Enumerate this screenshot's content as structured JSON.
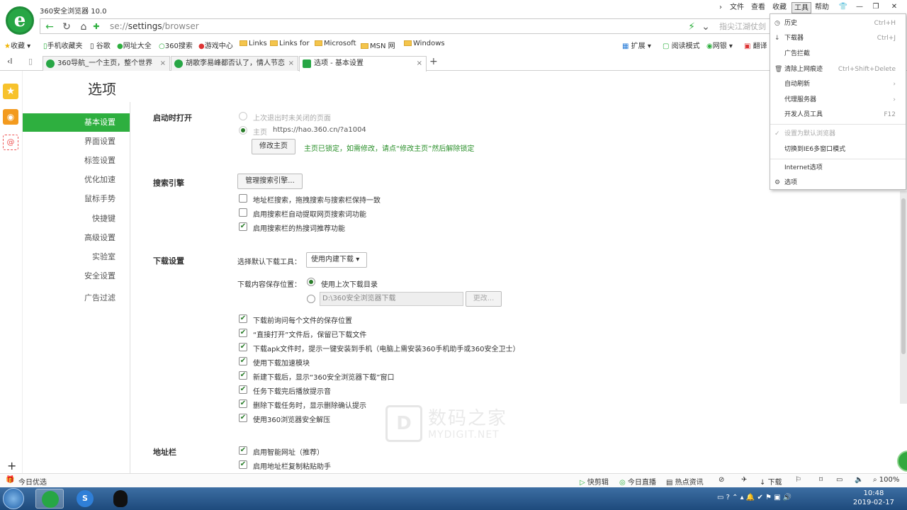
{
  "app": {
    "title": "360安全浏览器 10.0"
  },
  "top_menu": {
    "file": "文件",
    "view": "查看",
    "favorites": "收藏",
    "tools": "工具",
    "help": "帮助"
  },
  "address": {
    "url_prefix": "se://",
    "url_main": "settings",
    "url_suffix": "/browser",
    "search_placeholder": "指尖江湖仗剑"
  },
  "bookmarks": [
    {
      "label": "收藏"
    },
    {
      "label": "手机收藏夹"
    },
    {
      "label": "谷歌"
    },
    {
      "label": "网址大全"
    },
    {
      "label": "360搜索"
    },
    {
      "label": "游戏中心"
    },
    {
      "label": "Links"
    },
    {
      "label": "Links for"
    },
    {
      "label": "Microsoft"
    },
    {
      "label": "MSN 网"
    },
    {
      "label": "Windows"
    }
  ],
  "toolbar_right": {
    "extensions": "扩展",
    "reader": "阅读模式",
    "netbank": "网银",
    "translate": "翻译"
  },
  "tabs": [
    {
      "label": "360导航_一个主页，整个世界"
    },
    {
      "label": "胡歌李易峰都否认了，情人节恋"
    },
    {
      "label": "选项 - 基本设置"
    }
  ],
  "page": {
    "title": "选项"
  },
  "nav": [
    {
      "label": "基本设置"
    },
    {
      "label": "界面设置"
    },
    {
      "label": "标签设置"
    },
    {
      "label": "优化加速"
    },
    {
      "label": "鼠标手势"
    },
    {
      "label": "快捷键"
    },
    {
      "label": "高级设置"
    },
    {
      "label": "实验室"
    },
    {
      "label": "安全设置"
    },
    {
      "label": "广告过滤"
    }
  ],
  "startup": {
    "section": "启动时打开",
    "opt_last": "上次退出时未关闭的页面",
    "opt_home": "主页",
    "home_url": "https://hao.360.cn/?a1004",
    "change_button": "修改主页",
    "locked_note": "主页已锁定，如需修改，请点“修改主页”然后解除锁定"
  },
  "search": {
    "section": "搜索引擎",
    "manage_button": "管理搜索引擎...",
    "opt1": "地址栏搜索，拖拽搜索与搜索栏保持一致",
    "opt2": "启用搜索栏自动提取网页搜索词功能",
    "opt3": "启用搜索栏的热搜词推荐功能"
  },
  "download": {
    "section": "下载设置",
    "tool_label": "选择默认下载工具：",
    "tool_value": "使用内建下载",
    "location_label": "下载内容保存位置：",
    "loc_last": "使用上次下载目录",
    "loc_path": "D:\\360安全浏览器下载",
    "change_button": "更改...",
    "opts": [
      "下载前询问每个文件的保存位置",
      "“直接打开”文件后，保留已下载文件",
      "下载apk文件时，提示一键安装到手机（电脑上需安装360手机助手或360安全卫士）",
      "使用下载加速模块",
      "新建下载后，显示“360安全浏览器下载”窗口",
      "任务下载完后播放提示音",
      "删除下载任务时，显示删除确认提示",
      "使用360浏览器安全解压"
    ]
  },
  "addressbar": {
    "section": "地址栏",
    "opt1": "启用智能网址（推荐）",
    "opt2": "启用地址栏复制粘贴助手"
  },
  "watermark": {
    "cn": "数码之家",
    "en": "MYDIGIT.NET"
  },
  "tools_menu": {
    "history": "历史",
    "history_sc": "Ctrl+H",
    "downloads": "下载器",
    "downloads_sc": "Ctrl+J",
    "adblock": "广告拦截",
    "clear": "清除上网痕迹",
    "clear_sc": "Ctrl+Shift+Delete",
    "autorefresh": "自动刷新",
    "proxy": "代理服务器",
    "devtools": "开发人员工具",
    "devtools_sc": "F12",
    "default": "设置为默认浏览器",
    "ie6": "切换到IE6多窗口模式",
    "inet": "Internet选项",
    "options": "选项"
  },
  "status": {
    "left": "今日优选",
    "quick": "快剪辑",
    "live": "今日直播",
    "news": "热点资讯",
    "download": "下载",
    "zoom": "100%"
  },
  "taskbar": {
    "time": "10:48",
    "date": "2019-02-17"
  },
  "colors": {
    "accent_green": "#2eaf3f",
    "link_green": "#2a8f2a"
  }
}
